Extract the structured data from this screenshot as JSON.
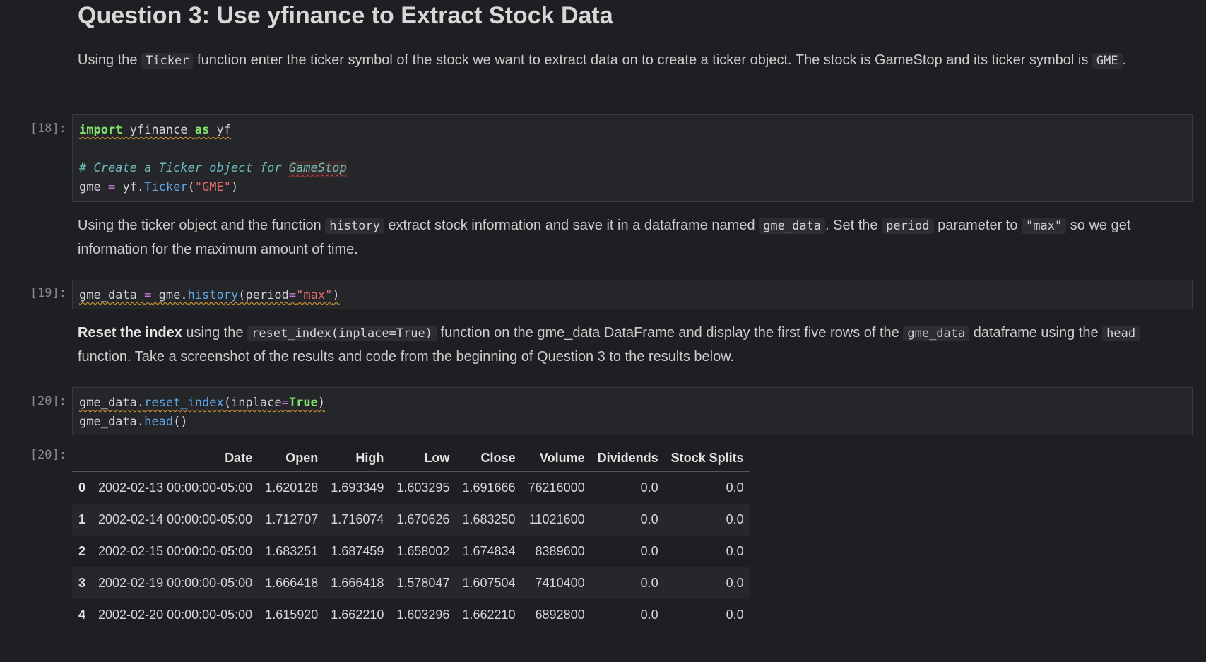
{
  "heading": "Question 3: Use yfinance to Extract Stock Data",
  "md1": {
    "t1": "Using the ",
    "c1": "Ticker",
    "t2": " function enter the ticker symbol of the stock we want to extract data on to create a ticker object. The stock is GameStop and its ticker symbol is ",
    "c2": "GME",
    "t3": "."
  },
  "cell18": {
    "prompt": "[18]:",
    "l1_kw1": "import",
    "l1_mod": " yfinance ",
    "l1_kw2": "as",
    "l1_alias": " yf",
    "comment_a": "# Create a Ticker object for ",
    "comment_b": "GameStop",
    "l3_var": "gme ",
    "l3_eq": "=",
    "l3_obj": " yf.",
    "l3_fn": "Ticker",
    "l3_open": "(",
    "l3_str": "\"GME\"",
    "l3_close": ")"
  },
  "md2": {
    "t1": "Using the ticker object and the function ",
    "c1": "history",
    "t2": " extract stock information and save it in a dataframe named ",
    "c2": "gme_data",
    "t3": ". Set the ",
    "c3": "period",
    "t4": " parameter to ",
    "c4": "\"max\"",
    "t5": " so we get information for the maximum amount of time."
  },
  "cell19": {
    "prompt": "[19]:",
    "var": "gme_data ",
    "eq": "=",
    "obj": " gme.",
    "fn": "history",
    "open": "(period",
    "eq2": "=",
    "str": "\"max\"",
    "close": ")"
  },
  "md3": {
    "bold": "Reset the index",
    "t1": " using the ",
    "c1": "reset_index(inplace=True)",
    "t2": " function on the gme_data DataFrame and display the first five rows of the ",
    "c2": "gme_data",
    "t3": " dataframe using the ",
    "c3": "head",
    "t4": " function. Take a screenshot of the results and code from the beginning of Question 3 to the results below."
  },
  "cell20": {
    "prompt": "[20]:",
    "l1_obj": "gme_data.",
    "l1_fn": "reset_index",
    "l1_open": "(inplace",
    "l1_eq": "=",
    "l1_true": "True",
    "l1_close": ")",
    "l2_obj": "gme_data.",
    "l2_fn": "head",
    "l2_call": "()"
  },
  "output20": {
    "prompt": "[20]:",
    "columns": [
      "",
      "Date",
      "Open",
      "High",
      "Low",
      "Close",
      "Volume",
      "Dividends",
      "Stock Splits"
    ],
    "rows": [
      [
        "0",
        "2002-02-13 00:00:00-05:00",
        "1.620128",
        "1.693349",
        "1.603295",
        "1.691666",
        "76216000",
        "0.0",
        "0.0"
      ],
      [
        "1",
        "2002-02-14 00:00:00-05:00",
        "1.712707",
        "1.716074",
        "1.670626",
        "1.683250",
        "11021600",
        "0.0",
        "0.0"
      ],
      [
        "2",
        "2002-02-15 00:00:00-05:00",
        "1.683251",
        "1.687459",
        "1.658002",
        "1.674834",
        "8389600",
        "0.0",
        "0.0"
      ],
      [
        "3",
        "2002-02-19 00:00:00-05:00",
        "1.666418",
        "1.666418",
        "1.578047",
        "1.607504",
        "7410400",
        "0.0",
        "0.0"
      ],
      [
        "4",
        "2002-02-20 00:00:00-05:00",
        "1.615920",
        "1.662210",
        "1.603296",
        "1.662210",
        "6892800",
        "0.0",
        "0.0"
      ]
    ]
  }
}
